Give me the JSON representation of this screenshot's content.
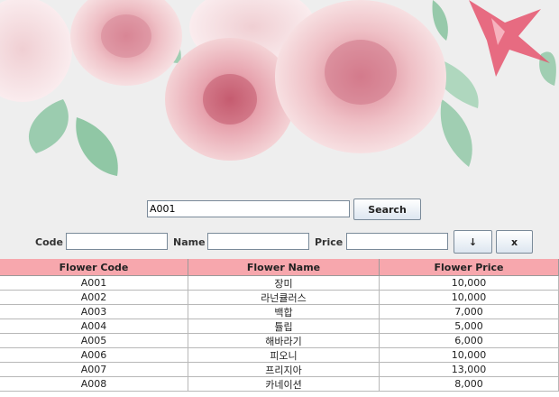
{
  "search": {
    "value": "A001",
    "button_label": "Search"
  },
  "form": {
    "code_label": "Code",
    "name_label": "Name",
    "price_label": "Price",
    "code_value": "",
    "name_value": "",
    "price_value": "",
    "down_button_label": "↓",
    "clear_button_label": "x"
  },
  "table": {
    "columns": [
      "Flower Code",
      "Flower Name",
      "Flower Price"
    ],
    "header_color": "#f7a7ad",
    "rows": [
      [
        "A001",
        "장미",
        "10,000"
      ],
      [
        "A002",
        "라넌큘러스",
        "10,000"
      ],
      [
        "A003",
        "백합",
        "7,000"
      ],
      [
        "A004",
        "튤립",
        "5,000"
      ],
      [
        "A005",
        "해바라기",
        "6,000"
      ],
      [
        "A006",
        "피오니",
        "10,000"
      ],
      [
        "A007",
        "프리지아",
        "13,000"
      ],
      [
        "A008",
        "카네이션",
        "8,000"
      ]
    ]
  }
}
